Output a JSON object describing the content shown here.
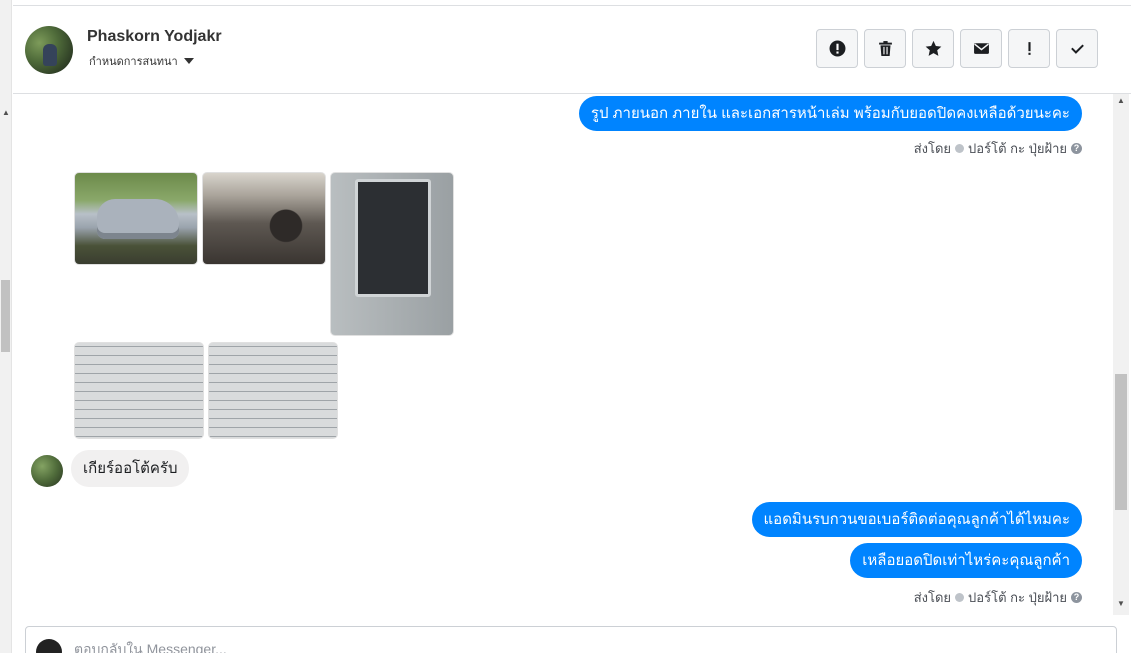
{
  "header": {
    "contact_name": "Phaskorn Yodjakr",
    "subtitle": "กำหนดการสนทนา",
    "toolbar": [
      {
        "name": "report-button",
        "icon": "alert-circle-icon"
      },
      {
        "name": "delete-button",
        "icon": "trash-icon"
      },
      {
        "name": "star-button",
        "icon": "star-icon"
      },
      {
        "name": "mail-button",
        "icon": "envelope-icon"
      },
      {
        "name": "important-button",
        "icon": "exclamation-icon"
      },
      {
        "name": "done-button",
        "icon": "checkmark-icon"
      }
    ]
  },
  "messages": {
    "outgoing_1": "รูป ภายนอก ภายใน และเอกสารหน้าเล่ม พร้อมกับยอดปิดคงเหลือด้วยนะคะ",
    "sent_by_1": {
      "prefix": "ส่งโดย",
      "agent": "ปอร์โต้ กะ ปุ่ยฝ้าย",
      "help": "?"
    },
    "photos": [
      {
        "name": "photo-car-exterior"
      },
      {
        "name": "photo-car-interior"
      },
      {
        "name": "photo-vin-label"
      },
      {
        "name": "photo-document-1"
      },
      {
        "name": "photo-document-2"
      }
    ],
    "incoming_1": "เกียร์ออโต้ครับ",
    "outgoing_2": "แอดมินรบกวนขอเบอร์ติดต่อคุณลูกค้าได้ไหมคะ",
    "outgoing_3": "เหลือยอดปิดเท่าไหร่คะคุณลูกค้า",
    "sent_by_2": {
      "prefix": "ส่งโดย",
      "agent": "ปอร์โต้ กะ ปุ่ยฝ้าย",
      "help": "?"
    }
  },
  "composer": {
    "placeholder": "ตอบกลับใน Messenger..."
  },
  "colors": {
    "outgoing_bubble": "#0084ff",
    "incoming_bubble": "#f1f0f0"
  }
}
